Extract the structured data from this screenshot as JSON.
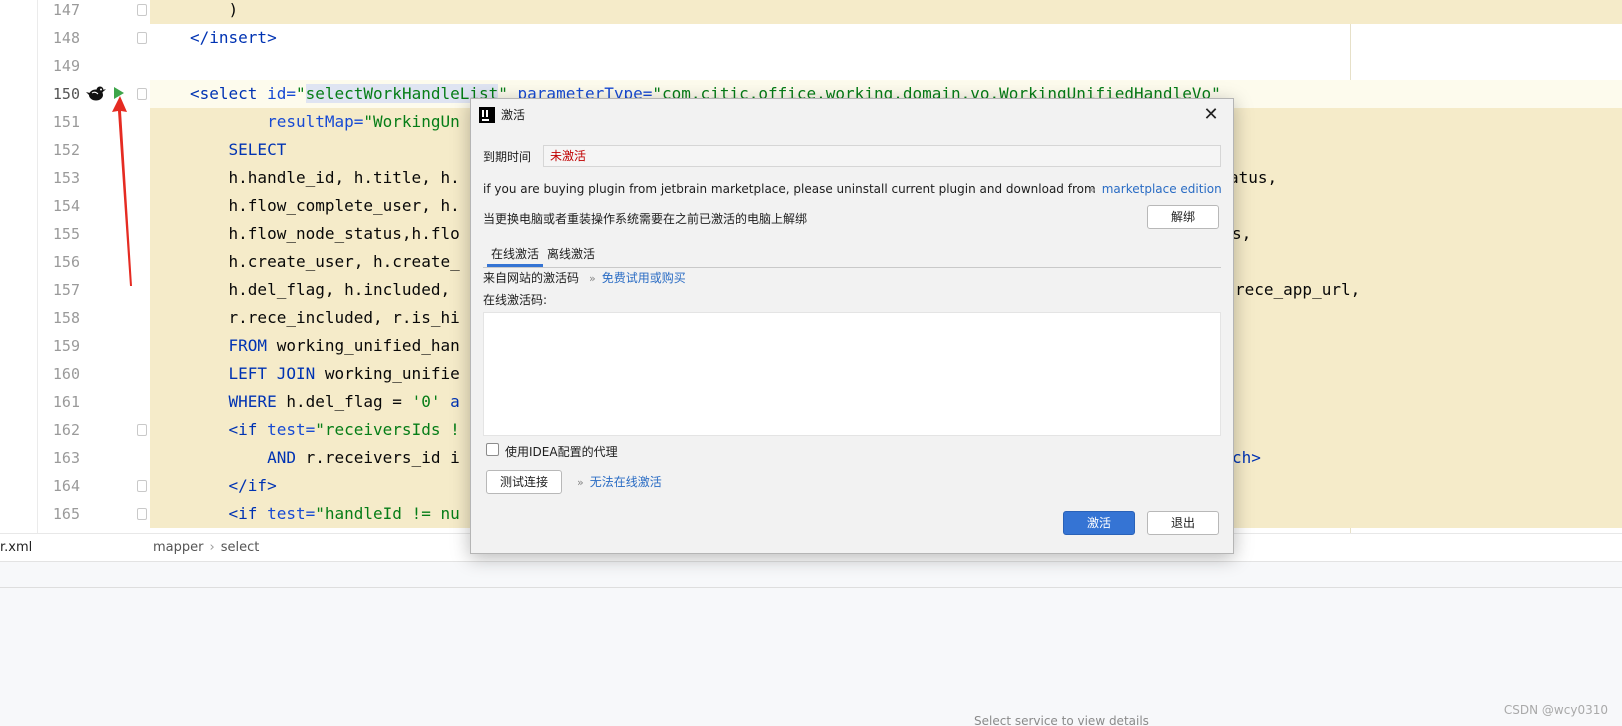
{
  "editor": {
    "lines": [
      {
        "num": "147",
        "parts": [
          {
            "t": "    )",
            "c": ""
          }
        ]
      },
      {
        "num": "148",
        "parts": [
          {
            "t": "</insert>",
            "c": "tag"
          }
        ]
      },
      {
        "num": "149",
        "parts": [
          {
            "t": "",
            "c": ""
          }
        ]
      },
      {
        "num": "150",
        "parts": [
          {
            "t": "<select ",
            "c": "tag"
          },
          {
            "t": "id=",
            "c": "attr"
          },
          {
            "t": "\"",
            "c": "str"
          },
          {
            "t": "selectWorkHandleList",
            "c": "str sel"
          },
          {
            "t": "\" ",
            "c": "str"
          },
          {
            "t": "parameterType=",
            "c": "attr"
          },
          {
            "t": "\"com.citic.office.working.domain.vo.WorkingUnifiedHandleVo\"",
            "c": "str"
          }
        ]
      },
      {
        "num": "151",
        "parts": [
          {
            "t": "        resultMap=",
            "c": "attr"
          },
          {
            "t": "\"WorkingUn",
            "c": "str"
          }
        ]
      },
      {
        "num": "152",
        "parts": [
          {
            "t": "    SELECT",
            "c": "kw"
          }
        ]
      },
      {
        "num": "153",
        "parts": [
          {
            "t": "    h.handle_id, h.title, h.",
            "c": ""
          }
        ]
      },
      {
        "num": "154",
        "parts": [
          {
            "t": "    h.flow_complete_user, h.",
            "c": ""
          }
        ]
      },
      {
        "num": "155",
        "parts": [
          {
            "t": "    h.flow_node_status,h.flo",
            "c": ""
          }
        ]
      },
      {
        "num": "156",
        "parts": [
          {
            "t": "    h.create_user, h.create_",
            "c": ""
          }
        ]
      },
      {
        "num": "157",
        "parts": [
          {
            "t": "    h.del_flag, h.included,",
            "c": ""
          }
        ]
      },
      {
        "num": "158",
        "parts": [
          {
            "t": "    r.rece_included, r.is_hi",
            "c": ""
          }
        ]
      },
      {
        "num": "159",
        "parts": [
          {
            "t": "    FROM ",
            "c": "kw"
          },
          {
            "t": "working_unified_han",
            "c": ""
          }
        ]
      },
      {
        "num": "160",
        "parts": [
          {
            "t": "    LEFT JOIN ",
            "c": "kw"
          },
          {
            "t": "working_unifie",
            "c": ""
          }
        ]
      },
      {
        "num": "161",
        "parts": [
          {
            "t": "    WHERE ",
            "c": "kw"
          },
          {
            "t": "h.del_flag = ",
            "c": ""
          },
          {
            "t": "'0'",
            "c": "str"
          },
          {
            "t": " a",
            "c": "kw"
          }
        ]
      },
      {
        "num": "162",
        "parts": [
          {
            "t": "    <if ",
            "c": "tag"
          },
          {
            "t": "test=",
            "c": "attr"
          },
          {
            "t": "\"receiversIds !",
            "c": "str"
          }
        ]
      },
      {
        "num": "163",
        "parts": [
          {
            "t": "        AND ",
            "c": "kw"
          },
          {
            "t": "r.receivers_id i",
            "c": ""
          }
        ]
      },
      {
        "num": "164",
        "parts": [
          {
            "t": "    </if>",
            "c": "tag"
          }
        ]
      },
      {
        "num": "165",
        "parts": [
          {
            "t": "    <if ",
            "c": "tag"
          },
          {
            "t": "test=",
            "c": "attr"
          },
          {
            "t": "\"handleId != nu",
            "c": "str"
          }
        ]
      }
    ],
    "right_fragments": {
      "153": "atus,",
      "155": "s,",
      "157": "rece_app_url,",
      "163": "ch>"
    }
  },
  "breadcrumb": {
    "file": "r.xml",
    "items": [
      "mapper",
      "select"
    ]
  },
  "bottom_panel": {
    "hint": "Select service to view details"
  },
  "watermark": "CSDN @wcy0310",
  "dialog": {
    "title": "激活",
    "expire_label": "到期时间",
    "expire_value": "未激活",
    "marketplace_text": "if you are buying plugin from jetbrain marketplace, please uninstall current plugin and download from",
    "marketplace_link": "marketplace edition",
    "unbind_text": "当更换电脑或者重装操作系统需要在之前已激活的电脑上解绑",
    "unbind_button": "解绑",
    "tabs": [
      "在线激活",
      "离线激活"
    ],
    "code_source_label": "来自网站的激活码",
    "free_trial_link": "免费试用或购买",
    "online_code_label": "在线激活码:",
    "online_code_value": "",
    "proxy_label": "使用IDEA配置的代理",
    "proxy_checked": false,
    "test_button": "测试连接",
    "cannot_activate_link": "无法在线激活",
    "activate_button": "激活",
    "exit_button": "退出"
  },
  "colors": {
    "accent": "#3574d4",
    "link": "#2a6cc4",
    "error": "#c00000",
    "highlight": "#f5ebc9"
  }
}
